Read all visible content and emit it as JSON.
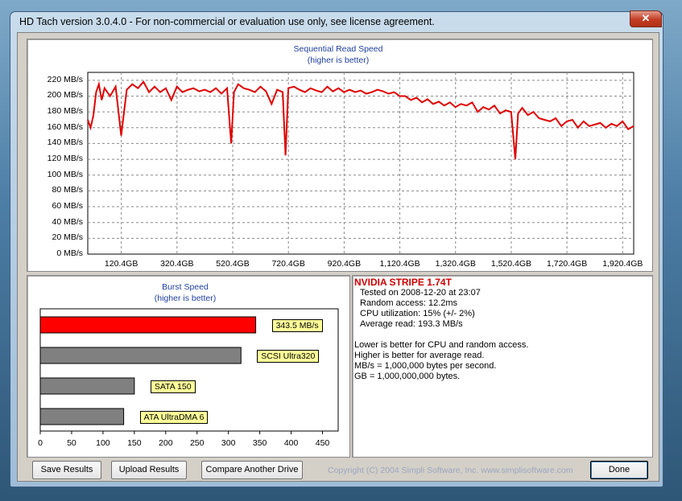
{
  "window": {
    "title": "HD Tach version 3.0.4.0  - For non-commercial or evaluation use only, see license agreement.",
    "close_glyph": "✕"
  },
  "chart_data": [
    {
      "type": "line",
      "title": "Sequential Read Speed",
      "subtitle": "(higher is better)",
      "x_tick_labels": [
        "120.4GB",
        "320.4GB",
        "520.4GB",
        "720.4GB",
        "920.4GB",
        "1,120.4GB",
        "1,320.4GB",
        "1,520.4GB",
        "1,720.4GB",
        "1,920.4GB"
      ],
      "y_tick_labels": [
        "0 MB/s",
        "20 MB/s",
        "40 MB/s",
        "60 MB/s",
        "80 MB/s",
        "100 MB/s",
        "120 MB/s",
        "140 MB/s",
        "160 MB/s",
        "180 MB/s",
        "200 MB/s",
        "220 MB/s"
      ],
      "ylim": [
        0,
        230
      ],
      "xlim": [
        0,
        1960
      ],
      "grid": true,
      "series_color": "#e00000",
      "x": [
        0,
        10,
        20,
        30,
        40,
        50,
        60,
        80,
        100,
        120,
        140,
        160,
        180,
        200,
        220,
        240,
        260,
        280,
        300,
        320,
        340,
        360,
        380,
        400,
        420,
        440,
        460,
        480,
        500,
        515,
        525,
        540,
        560,
        580,
        600,
        620,
        640,
        660,
        680,
        700,
        710,
        720,
        740,
        760,
        780,
        800,
        820,
        840,
        860,
        880,
        900,
        920,
        940,
        960,
        980,
        1000,
        1020,
        1040,
        1060,
        1080,
        1100,
        1120,
        1140,
        1160,
        1180,
        1200,
        1220,
        1240,
        1260,
        1280,
        1300,
        1320,
        1340,
        1360,
        1380,
        1400,
        1420,
        1440,
        1460,
        1480,
        1500,
        1520,
        1535,
        1545,
        1560,
        1580,
        1600,
        1620,
        1640,
        1660,
        1680,
        1700,
        1720,
        1740,
        1760,
        1780,
        1800,
        1820,
        1840,
        1860,
        1880,
        1900,
        1920,
        1940,
        1960
      ],
      "y": [
        170,
        160,
        175,
        205,
        215,
        195,
        210,
        200,
        212,
        150,
        208,
        215,
        210,
        218,
        205,
        212,
        205,
        210,
        195,
        212,
        205,
        208,
        210,
        206,
        208,
        205,
        210,
        203,
        210,
        140,
        205,
        215,
        210,
        208,
        205,
        212,
        206,
        190,
        208,
        205,
        125,
        210,
        212,
        208,
        205,
        210,
        207,
        205,
        212,
        206,
        210,
        205,
        208,
        205,
        207,
        203,
        205,
        208,
        206,
        203,
        205,
        200,
        200,
        195,
        198,
        192,
        196,
        190,
        193,
        188,
        192,
        186,
        190,
        188,
        192,
        180,
        186,
        183,
        188,
        178,
        182,
        180,
        120,
        178,
        185,
        176,
        180,
        172,
        170,
        168,
        172,
        162,
        168,
        170,
        160,
        168,
        162,
        164,
        166,
        160,
        165,
        162,
        168,
        158,
        162
      ]
    },
    {
      "type": "bar",
      "orientation": "horizontal",
      "title": "Burst Speed",
      "subtitle": "(higher is better)",
      "categories": [
        "343.5 MB/s",
        "SCSI Ultra320",
        "SATA 150",
        "ATA UltraDMA 6"
      ],
      "values": [
        343.5,
        320,
        150,
        133
      ],
      "colors": [
        "#ff0000",
        "#808080",
        "#808080",
        "#808080"
      ],
      "xlim": [
        0,
        475
      ],
      "x_tick_labels": [
        "0",
        "50",
        "100",
        "150",
        "200",
        "250",
        "300",
        "350",
        "400",
        "450"
      ]
    }
  ],
  "info": {
    "drive": "NVIDIA STRIPE 1.74T",
    "tested": "Tested on 2008-12-20 at 23:07",
    "random_access": "Random access: 12.2ms",
    "cpu": "CPU utilization: 15% (+/- 2%)",
    "avg_read": "Average read: 193.3 MB/s",
    "note1": "Lower is better for CPU and random access.",
    "note2": "Higher is better for average read.",
    "note3": "MB/s = 1,000,000 bytes per second.",
    "note4": "GB = 1,000,000,000 bytes."
  },
  "buttons": {
    "save": "Save Results",
    "upload": "Upload Results",
    "compare": "Compare Another Drive",
    "done": "Done"
  },
  "copyright": "Copyright (C) 2004 Simpli Software, Inc. www.simplisoftware.com"
}
